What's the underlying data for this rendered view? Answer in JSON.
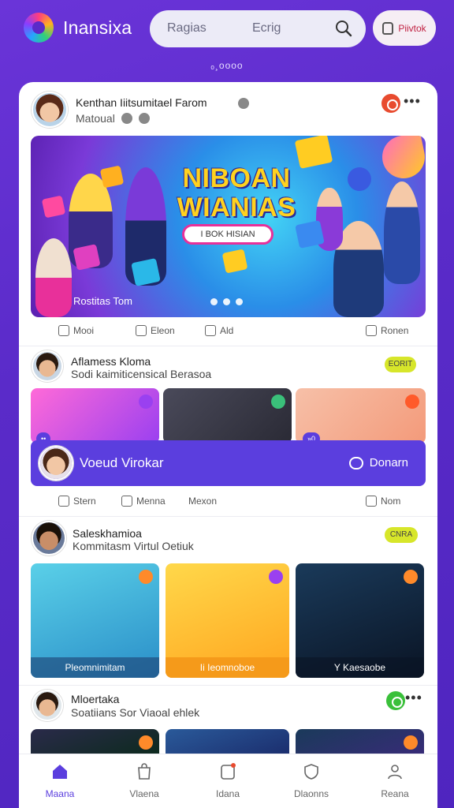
{
  "app": {
    "name": "Inansixa"
  },
  "search": {
    "left_text": "Ragias",
    "right_text": "Ecrig"
  },
  "profile_button": {
    "label": "Piivtok"
  },
  "subline": "ₒ¸oooo",
  "post1": {
    "author": "Kenthan Iiitsumitael Farom",
    "subtitle": "Matoual",
    "hero_title_line1": "NIBOAN",
    "hero_title_line2": "WIANIAS",
    "hero_tag": "I BOK HISIAN",
    "hero_caption": "Rostitas Tom",
    "actions": [
      "Mooi",
      "Eleon",
      "Ald",
      "Ronen"
    ]
  },
  "post2": {
    "author": "Aflamess Kloma",
    "subtitle": "Sodi kaimiticensical Berasoa",
    "pill": "EORIT",
    "video_counter_left": "••",
    "video_counter_right": "»0",
    "video_bar_name": "Voeud Virokar",
    "video_bar_action": "Donarn",
    "actions": [
      "Stern",
      "Menna",
      "Mexon",
      "Nom"
    ]
  },
  "post3": {
    "author": "Saleskhamioa",
    "subtitle": "Kommitasm Virtul Oetiuk",
    "pill": "CNRA",
    "thumbs": [
      "Pleomnimitam",
      "Ii Ieomnoboe",
      "Y Kaesaobe"
    ]
  },
  "post4": {
    "author": "Mloertaka",
    "subtitle": "Soatiians Sor Viaoal ehlek"
  },
  "nav": [
    {
      "label": "Maana",
      "icon": "home-icon"
    },
    {
      "label": "Vlaena",
      "icon": "bag-icon"
    },
    {
      "label": "Idana",
      "icon": "notifications-icon"
    },
    {
      "label": "Dlaonns",
      "icon": "shield-icon"
    },
    {
      "label": "Reana",
      "icon": "profile-icon"
    }
  ],
  "colors": {
    "accent": "#5b3ede",
    "background": "#5a2bc9",
    "pill": "#d7e62a"
  }
}
